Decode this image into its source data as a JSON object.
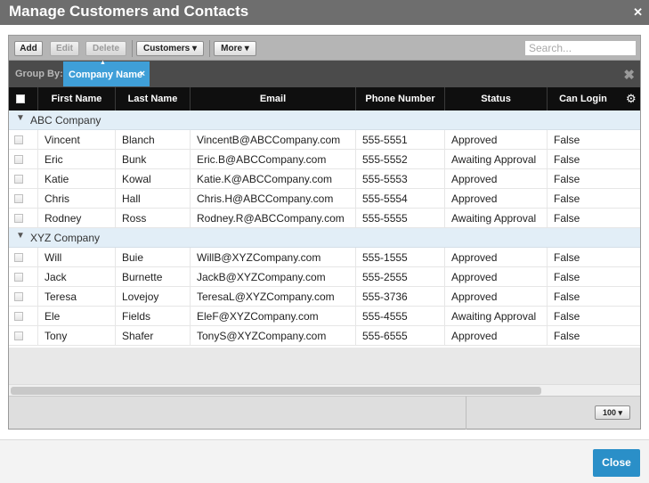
{
  "dialog": {
    "title": "Manage Customers and Contacts",
    "close_icon": "close-icon",
    "close_label": "Close"
  },
  "toolbar": {
    "add_label": "Add",
    "edit_label": "Edit",
    "delete_label": "Delete",
    "customers_label": "Customers ▾",
    "more_label": "More ▾",
    "search_placeholder": "Search..."
  },
  "groupbar": {
    "label": "Group By:",
    "chip_label": "Company Name",
    "chip_remove": "×",
    "clear_icon": "✖"
  },
  "columns": [
    "First Name",
    "Last Name",
    "Email",
    "Phone Number",
    "Status",
    "Can Login"
  ],
  "groups": [
    {
      "name": "ABC Company",
      "rows": [
        [
          "Vincent",
          "Blanch",
          "VincentB@ABCCompany.com",
          "555-5551",
          "Approved",
          "False"
        ],
        [
          "Eric",
          "Bunk",
          "Eric.B@ABCCompany.com",
          "555-5552",
          "Awaiting Approval",
          "False"
        ],
        [
          "Katie",
          "Kowal",
          "Katie.K@ABCCompany.com",
          "555-5553",
          "Approved",
          "False"
        ],
        [
          "Chris",
          "Hall",
          "Chris.H@ABCCompany.com",
          "555-5554",
          "Approved",
          "False"
        ],
        [
          "Rodney",
          "Ross",
          "Rodney.R@ABCCompany.com",
          "555-5555",
          "Awaiting Approval",
          "False"
        ]
      ]
    },
    {
      "name": "XYZ Company",
      "rows": [
        [
          "Will",
          "Buie",
          "WillB@XYZCompany.com",
          "555-1555",
          "Approved",
          "False"
        ],
        [
          "Jack",
          "Burnette",
          "JackB@XYZCompany.com",
          "555-2555",
          "Approved",
          "False"
        ],
        [
          "Teresa",
          "Lovejoy",
          "TeresaL@XYZCompany.com",
          "555-3736",
          "Approved",
          "False"
        ],
        [
          "Ele",
          "Fields",
          "EleF@XYZCompany.com",
          "555-4555",
          "Awaiting Approval",
          "False"
        ],
        [
          "Tony",
          "Shafer",
          "TonyS@XYZCompany.com",
          "555-6555",
          "Approved",
          "False"
        ]
      ]
    }
  ],
  "footer": {
    "page_size": "100 ▾"
  },
  "colors": {
    "titlebar": "#6e6e6e",
    "group_chip": "#3f9fd8",
    "header": "#0f0f0f",
    "group_row": "#e2eef7",
    "close_button": "#2a8fc8"
  }
}
